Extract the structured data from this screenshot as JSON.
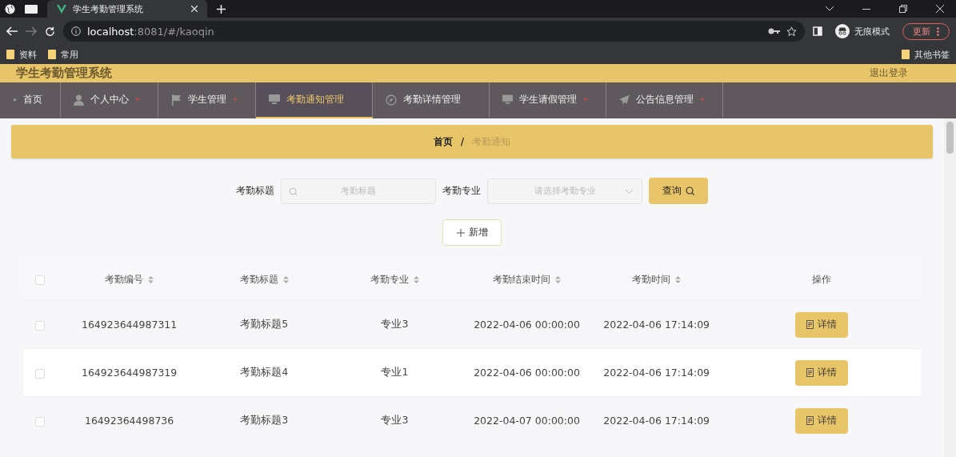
{
  "browser": {
    "tabs": [
      {
        "title": "学生考勤管理系统",
        "selected": true
      }
    ],
    "url_host": "localhost",
    "url_rest": ":8081/#/kaoqin",
    "profile": "无痕模式",
    "update_button": "更新",
    "bookmarks": [
      "资料",
      "常用"
    ],
    "other_bookmarks": "其他书签"
  },
  "app": {
    "title": "学生考勤管理系统",
    "logout": "退出登录"
  },
  "nav": [
    {
      "label": "首页",
      "selected": false,
      "has_menu": false
    },
    {
      "label": "个人中心",
      "selected": false,
      "has_menu": true
    },
    {
      "label": "学生管理",
      "selected": false,
      "has_menu": true
    },
    {
      "label": "考勤通知管理",
      "selected": true,
      "has_menu": false
    },
    {
      "label": "考勤详情管理",
      "selected": false,
      "has_menu": false
    },
    {
      "label": "学生请假管理",
      "selected": false,
      "has_menu": true
    },
    {
      "label": "公告信息管理",
      "selected": false,
      "has_menu": true
    }
  ],
  "breadcrumb": [
    "首页",
    "考勤通知"
  ],
  "breadcrumb_separator": "/",
  "search": {
    "fields": [
      {
        "kind": "text",
        "label": "考勤标题",
        "placeholder": "考勤标题"
      },
      {
        "kind": "select",
        "label": "考勤专业",
        "placeholder": "请选择考勤专业"
      }
    ],
    "button": "查询"
  },
  "add_button": "新增",
  "table": {
    "header_checked": false,
    "columns": [
      {
        "label": "考勤编号",
        "sortable": true
      },
      {
        "label": "考勤标题",
        "sortable": true
      },
      {
        "label": "考勤专业",
        "sortable": true
      },
      {
        "label": "考勤结束时间",
        "sortable": true
      },
      {
        "label": "考勤时间",
        "sortable": true
      },
      {
        "label": "操作",
        "sortable": false
      }
    ],
    "rows": [
      {
        "checked": false,
        "cells": [
          "164923644987311",
          "考勤标题5",
          "专业3",
          "2022-04-06 00:00:00",
          "2022-04-06 17:14:09"
        ],
        "action": "详情"
      },
      {
        "checked": false,
        "cells": [
          "164923644987319",
          "考勤标题4",
          "专业1",
          "2022-04-06 00:00:00",
          "2022-04-06 17:14:09"
        ],
        "action": "详情"
      },
      {
        "checked": false,
        "cells": [
          "16492364498736",
          "考勤标题3",
          "专业3",
          "2022-04-07 00:00:00",
          "2022-04-06 17:14:09"
        ],
        "action": "详情"
      }
    ]
  }
}
